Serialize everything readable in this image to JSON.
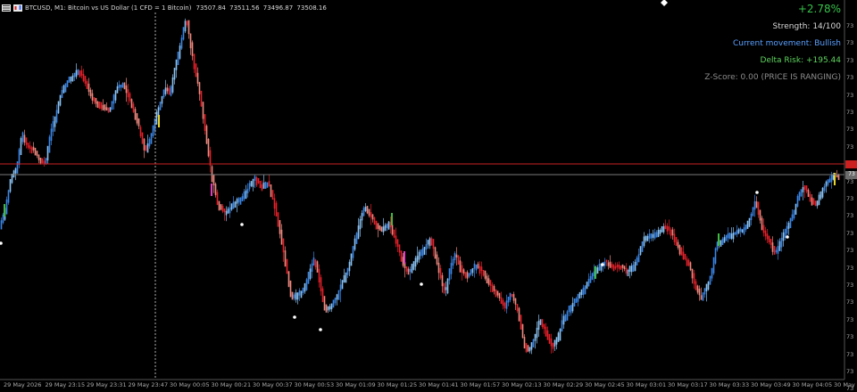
{
  "header": {
    "title": "BTCUSD, M1:  Bitcoin vs US Dollar (1 CFD = 1 Bitcoin)",
    "ohlc": [
      "73507.84",
      "73511.56",
      "73496.87",
      "73508.16"
    ]
  },
  "indicator_panel": {
    "change_pct": "+2.78%",
    "strength": "Strength: 14/100",
    "movement": "Current movement: Bullish",
    "delta_risk": "Delta Risk: +195.44",
    "zscore": "Z-Score: 0.00 (PRICE IS RANGING)"
  },
  "colors": {
    "bull_strong": "#3a86e8",
    "bull_weak": "#8cc4f4",
    "bear_strong": "#e8202a",
    "bear_weak": "#f08a80",
    "pct_green": "#36c24a",
    "movement_blue": "#5aa0ff",
    "delta_green": "#5ed35e",
    "zscore_gray": "#8c8c8c",
    "red_line": "#cc1f1f",
    "gray_line": "#7a7a7a"
  },
  "x_axis": {
    "labels": [
      "29 May 2026",
      "29 May 23:15",
      "29 May 23:31",
      "29 May 23:47",
      "30 May 00:05",
      "30 May 00:21",
      "30 May 00:37",
      "30 May 00:53",
      "30 May 01:09",
      "30 May 01:25",
      "30 May 01:41",
      "30 May 01:57",
      "30 May 02:13",
      "30 May 02:29",
      "30 May 02:45",
      "30 May 03:01",
      "30 May 03:17",
      "30 May 03:33",
      "30 May 03:49",
      "30 May 04:05",
      "30 May 0"
    ]
  },
  "y_axis": {
    "labels": [
      "73",
      "73",
      "73",
      "73",
      "73",
      "73",
      "73",
      "73",
      "73",
      "73",
      "73",
      "73",
      "73",
      "73",
      "73",
      "73",
      "73",
      "73",
      "73",
      "73",
      "73",
      "73"
    ]
  },
  "current_price_tag": "73"
}
